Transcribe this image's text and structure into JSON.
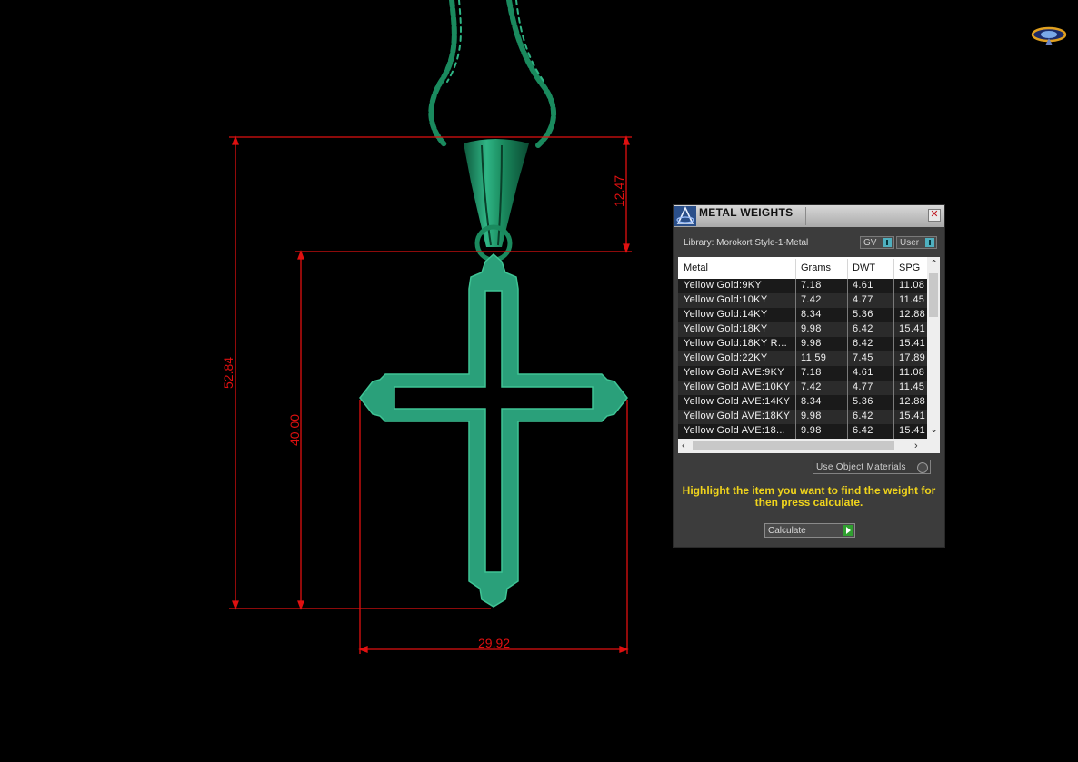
{
  "dimensions": {
    "top_bail": "12.47",
    "overall_height": "52.84",
    "cross_height": "40.00",
    "cross_width": "29.92"
  },
  "colors": {
    "model": "#1a8a5e",
    "model_light": "#2fb585",
    "dimension_line": "#e01010",
    "hint_text": "#f0d41c"
  },
  "panel": {
    "title": "METAL WEIGHTS",
    "close_icon": "close-icon",
    "library_label": "Library: Morokort Style-1-Metal",
    "toggle_gv": "GV",
    "toggle_user": "User",
    "columns": [
      "Metal",
      "Grams",
      "DWT",
      "SPG"
    ],
    "rows": [
      [
        "Yellow Gold:9KY",
        "7.18",
        "4.61",
        "11.08"
      ],
      [
        "Yellow Gold:10KY",
        "7.42",
        "4.77",
        "11.45"
      ],
      [
        "Yellow Gold:14KY",
        "8.34",
        "5.36",
        "12.88"
      ],
      [
        "Yellow Gold:18KY",
        "9.98",
        "6.42",
        "15.41"
      ],
      [
        "Yellow Gold:18KY R...",
        "9.98",
        "6.42",
        "15.41"
      ],
      [
        "Yellow Gold:22KY",
        "11.59",
        "7.45",
        "17.89"
      ],
      [
        "Yellow Gold AVE:9KY",
        "7.18",
        "4.61",
        "11.08"
      ],
      [
        "Yellow Gold AVE:10KY",
        "7.42",
        "4.77",
        "11.45"
      ],
      [
        "Yellow Gold AVE:14KY",
        "8.34",
        "5.36",
        "12.88"
      ],
      [
        "Yellow Gold AVE:18KY",
        "9.98",
        "6.42",
        "15.41"
      ],
      [
        "Yellow Gold AVE:18...",
        "9.98",
        "6.42",
        "15.41"
      ]
    ],
    "use_object_materials": "Use Object Materials",
    "hint": "Highlight the item you want to find the weight for then press calculate.",
    "calculate_label": "Calculate"
  }
}
